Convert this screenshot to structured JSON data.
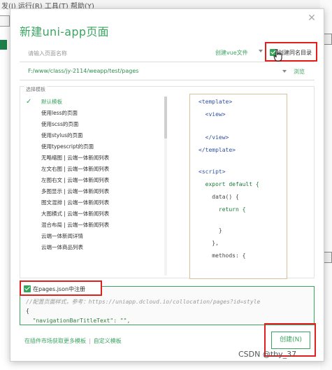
{
  "background": {
    "top_text": "发(J)  运行(R)  工具(T)  帮助(Y)"
  },
  "dialog": {
    "title": "新建uni-app页面",
    "close_glyph": "✕",
    "name_placeholder": "请输入页面名称",
    "file_type": "创建vue文件",
    "create_same_dir_label": "创建同名目录",
    "path": "F:/www/class/jy-2114/weapp/test/pages",
    "browse_label": "浏览",
    "template_legend": "选择模板",
    "templates": [
      "默认模板",
      "使用less的页面",
      "使用scss的页面",
      "使用stylus的页面",
      "使用typescript的页面",
      "无略缩图 | 云端一体新闻列表",
      "左文右图 | 云端一体新闻列表",
      "左图右文 | 云端一体新闻列表",
      "多图显示 | 云端一体新闻列表",
      "图文混排 | 云端一体新闻列表",
      "大图横式 | 云端一体新闻列表",
      "混合布局 | 云端一体新闻列表",
      "云端一体新闻详情",
      "云端一体商品列表"
    ],
    "code_lines": [
      "<template>",
      "  <view>",
      "",
      "  </view>",
      "</template>",
      "",
      "<script>",
      "  export default {",
      "    data() {",
      "      return {",
      "",
      "      }",
      "    },",
      "    methods: {"
    ],
    "register_json_label": "在pages.json中注册",
    "json_comment": "//配置页面样式，参考：https://uniapp.dcloud.io/collocation/pages?id=style",
    "json_brace": "{",
    "json_key_line": "  \"navigationBarTitleText\": \"\",",
    "link_more_templates": "在插件市场获取更多模板",
    "link_separator": "|",
    "link_custom_template": "自定义模板",
    "create_button": "创建(N)"
  },
  "watermark": "CSDN @tby_37",
  "colors": {
    "accent": "#3aa55f",
    "highlight_red": "#e0201a",
    "code_border": "#d9c29a"
  }
}
